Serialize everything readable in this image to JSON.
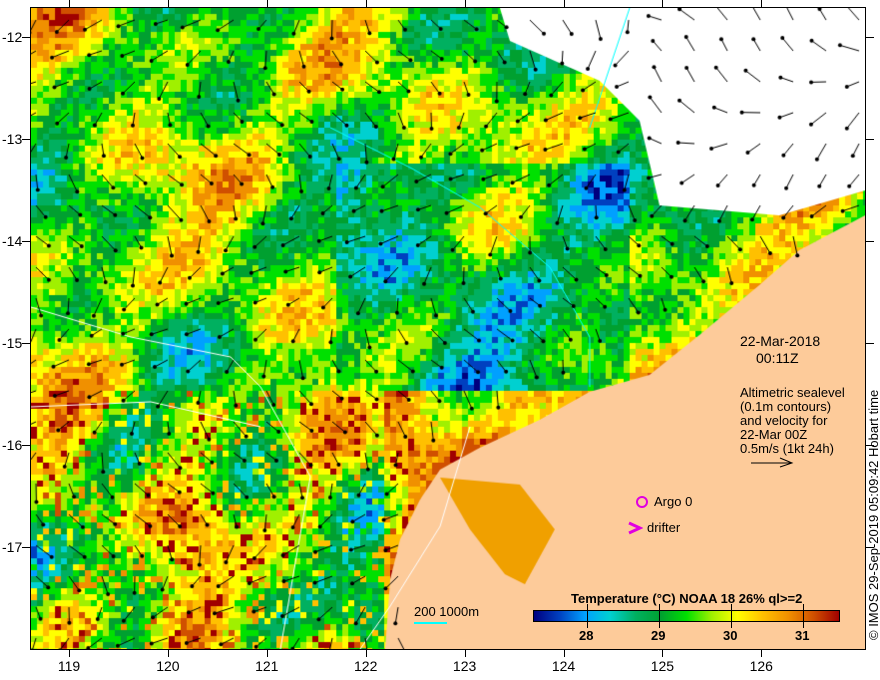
{
  "map": {
    "x_ticks": [
      "119",
      "120",
      "121",
      "122",
      "123",
      "124",
      "125",
      "126"
    ],
    "y_ticks": [
      "-12",
      "-13",
      "-14",
      "-15",
      "-16",
      "-17"
    ],
    "date": "22-Mar-2018",
    "time": "00:11Z",
    "altimetry_note": [
      "Altimetric sealevel",
      "(0.1m contours)",
      "and velocity for",
      "22-Mar 00Z",
      "0.5m/s (1kt 24h)"
    ],
    "legend": {
      "argo": "Argo 0",
      "drifter": "drifter",
      "argo_color": "#e000e0"
    },
    "depth_label": "200  1000m",
    "credit": "© IMOS 29-Sep-2019 05:09:42 Hobart time"
  },
  "colorbar": {
    "title": "Temperature (°C) NOAA 18 26% ql>=2",
    "ticks": [
      "28",
      "29",
      "30",
      "31"
    ],
    "range": [
      27.25,
      31.5
    ]
  },
  "colors": {
    "land": "#fdcb9a",
    "nodata": "#ffffff",
    "contour": "#00ffff"
  }
}
